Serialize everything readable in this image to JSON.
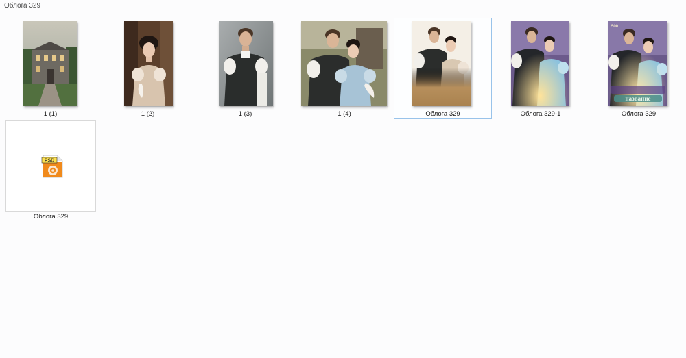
{
  "folder": {
    "title": "Облога 329"
  },
  "files": [
    {
      "label": "1 (1)",
      "kind": "image",
      "subject": "manor-house"
    },
    {
      "label": "1 (2)",
      "kind": "image",
      "subject": "woman-portrait"
    },
    {
      "label": "1 (3)",
      "kind": "image",
      "subject": "man-portrait"
    },
    {
      "label": "1 (4)",
      "kind": "image",
      "subject": "couple"
    },
    {
      "label": "Облога  329",
      "kind": "image",
      "subject": "couple-faded",
      "selected": true
    },
    {
      "label": "Облога  329-1",
      "kind": "image",
      "subject": "couple-cover-draft"
    },
    {
      "label": "Облога 329",
      "kind": "image",
      "subject": "couple-cover-final"
    },
    {
      "label": "Облога 329",
      "kind": "psd"
    }
  ],
  "cover_text": {
    "top_left": "500",
    "title": "название"
  },
  "psd_badge": "PSD",
  "colors": {
    "selection_border": "#99c3ea",
    "psd_orange": "#f08a1c",
    "psd_yellow": "#ffe14d"
  }
}
